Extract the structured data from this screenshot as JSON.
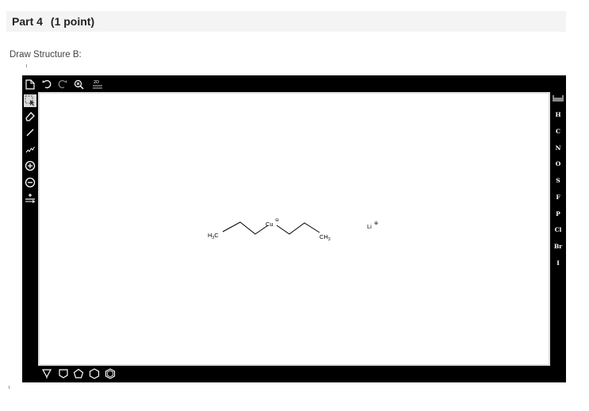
{
  "header": {
    "part": "Part 4",
    "points": "(1 point)"
  },
  "instruction": "Draw Structure B:",
  "top_toolbar": {
    "icons": [
      "new-document-icon",
      "undo-icon",
      "redo-icon",
      "zoom-icon",
      "2d-clean-icon"
    ],
    "clean_label": "2D"
  },
  "left_toolbar": {
    "icons": [
      "select-tool-icon",
      "eraser-icon",
      "single-bond-icon",
      "chain-icon",
      "plus-charge-icon",
      "minus-charge-icon",
      "reaction-arrow-icon"
    ],
    "selected": "select-tool-icon"
  },
  "right_toolbar": {
    "atoms": [
      "H",
      "C",
      "N",
      "O",
      "S",
      "F",
      "P",
      "Cl",
      "Br",
      "I"
    ]
  },
  "bottom_toolbar": {
    "templates": [
      "cyclopropane-icon",
      "cyclobutane-icon",
      "cyclopentane-icon",
      "cyclohexane-icon",
      "benzene-icon"
    ]
  },
  "molecule": {
    "left_group": "H",
    "left_group_sub": "3",
    "left_group_atom": "C",
    "center_atom": "Cu",
    "center_charge": "⊖",
    "right_group": "CH",
    "right_group_sub": "3",
    "counter_ion": "Li",
    "counter_charge": "⊕"
  },
  "colors": {
    "editor_bg": "#000000",
    "canvas_bg": "#ffffff",
    "header_bg": "#f4f4f4",
    "selected_tool": "#d9d9d9"
  }
}
